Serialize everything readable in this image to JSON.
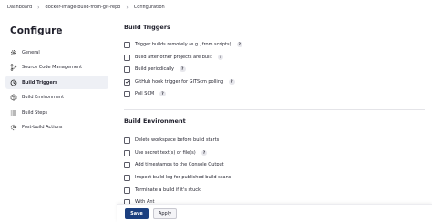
{
  "breadcrumb": {
    "items": [
      "Dashboard",
      "docker-image-build-from-git-repo",
      "Configuration"
    ]
  },
  "page": {
    "title": "Configure"
  },
  "sidebar": {
    "items": [
      {
        "label": "General",
        "icon": "gear-icon",
        "active": false
      },
      {
        "label": "Source Code Management",
        "icon": "code-branch-icon",
        "active": false
      },
      {
        "label": "Build Triggers",
        "icon": "clock-icon",
        "active": true
      },
      {
        "label": "Build Environment",
        "icon": "cube-icon",
        "active": false
      },
      {
        "label": "Build Steps",
        "icon": "list-icon",
        "active": false
      },
      {
        "label": "Post-build Actions",
        "icon": "cog-icon",
        "active": false
      }
    ]
  },
  "build_triggers": {
    "title": "Build Triggers",
    "options": [
      {
        "label": "Trigger builds remotely (e.g., from scripts)",
        "checked": false,
        "help": "?"
      },
      {
        "label": "Build after other projects are built",
        "checked": false,
        "help": "?"
      },
      {
        "label": "Build periodically",
        "checked": false,
        "help": "?"
      },
      {
        "label": "GitHub hook trigger for GITScm polling",
        "checked": true,
        "help": "?"
      },
      {
        "label": "Poll SCM",
        "checked": false,
        "help": "?"
      }
    ]
  },
  "build_environment": {
    "title": "Build Environment",
    "options": [
      {
        "label": "Delete workspace before build starts",
        "checked": false
      },
      {
        "label": "Use secret text(s) or file(s)",
        "checked": false,
        "help": "?"
      },
      {
        "label": "Add timestamps to the Console Output",
        "checked": false
      },
      {
        "label": "Inspect build log for published build scans",
        "checked": false
      },
      {
        "label": "Terminate a build if it's stuck",
        "checked": false
      },
      {
        "label": "With Ant",
        "checked": false
      }
    ]
  },
  "footer": {
    "save_label": "Save",
    "apply_label": "Apply"
  },
  "colors": {
    "primary": "#1b3f7f",
    "active_nav_bg": "#eef0f5"
  }
}
